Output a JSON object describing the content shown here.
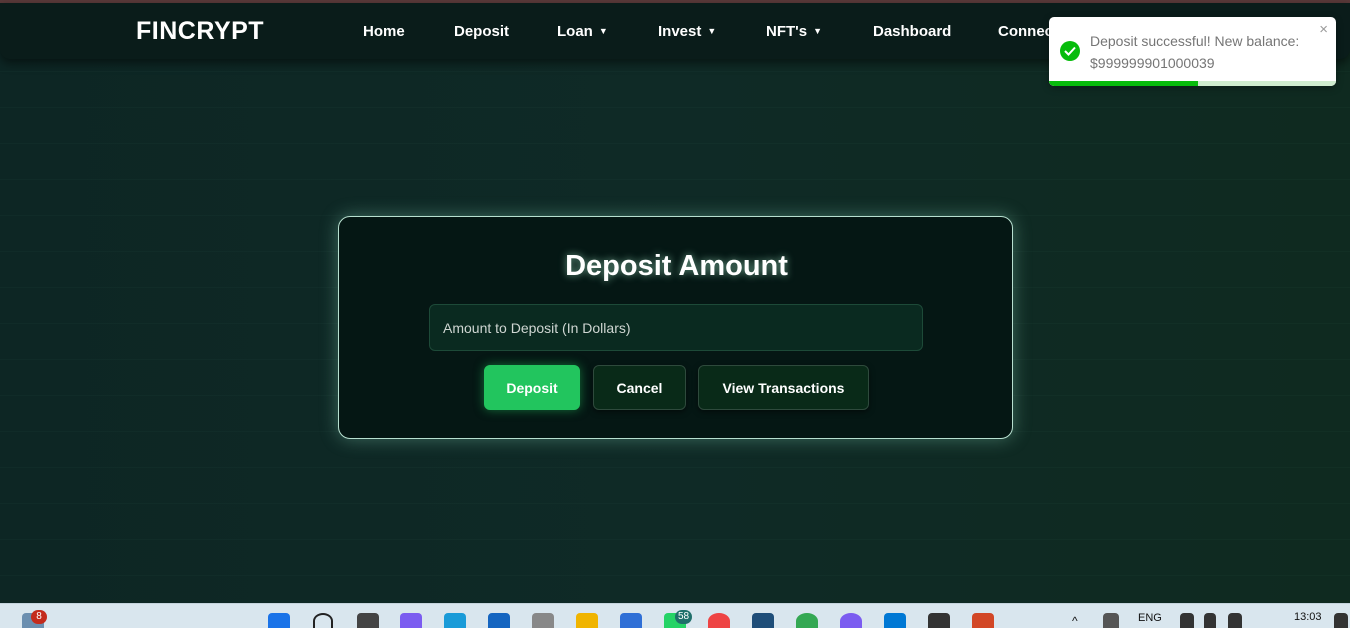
{
  "brand": {
    "logo": "FINCRYPT"
  },
  "nav": {
    "items": [
      {
        "label": "Home",
        "dropdown": false
      },
      {
        "label": "Deposit",
        "dropdown": false
      },
      {
        "label": "Loan",
        "dropdown": true
      },
      {
        "label": "Invest",
        "dropdown": true
      },
      {
        "label": "NFT's",
        "dropdown": true
      },
      {
        "label": "Dashboard",
        "dropdown": false
      },
      {
        "label": "Connec",
        "dropdown": false
      }
    ],
    "caret": "▼"
  },
  "toast": {
    "message": "Deposit successful! New balance: $999999901000039",
    "close_icon": "×",
    "progress": 0.52,
    "accent": "#07bc0c"
  },
  "deposit": {
    "title": "Deposit Amount",
    "amount_placeholder": "Amount to Deposit (In Dollars)",
    "amount_value": "",
    "deposit_label": "Deposit",
    "cancel_label": "Cancel",
    "transactions_label": "View Transactions"
  },
  "taskbar": {
    "notification_count": "8",
    "whatsapp_count": "58",
    "language": "ENG",
    "time": "13:03"
  },
  "colors": {
    "primary_button": "#22c55e",
    "background": "#0f2321"
  }
}
